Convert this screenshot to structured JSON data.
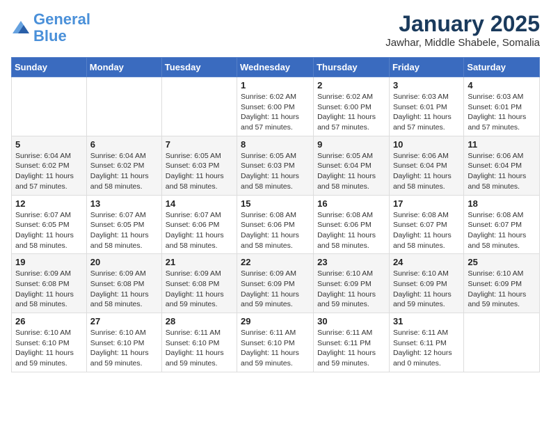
{
  "logo": {
    "line1": "General",
    "line2": "Blue"
  },
  "title": "January 2025",
  "subtitle": "Jawhar, Middle Shabele, Somalia",
  "days_header": [
    "Sunday",
    "Monday",
    "Tuesday",
    "Wednesday",
    "Thursday",
    "Friday",
    "Saturday"
  ],
  "weeks": [
    [
      {
        "day": "",
        "info": ""
      },
      {
        "day": "",
        "info": ""
      },
      {
        "day": "",
        "info": ""
      },
      {
        "day": "1",
        "info": "Sunrise: 6:02 AM\nSunset: 6:00 PM\nDaylight: 11 hours and 57 minutes."
      },
      {
        "day": "2",
        "info": "Sunrise: 6:02 AM\nSunset: 6:00 PM\nDaylight: 11 hours and 57 minutes."
      },
      {
        "day": "3",
        "info": "Sunrise: 6:03 AM\nSunset: 6:01 PM\nDaylight: 11 hours and 57 minutes."
      },
      {
        "day": "4",
        "info": "Sunrise: 6:03 AM\nSunset: 6:01 PM\nDaylight: 11 hours and 57 minutes."
      }
    ],
    [
      {
        "day": "5",
        "info": "Sunrise: 6:04 AM\nSunset: 6:02 PM\nDaylight: 11 hours and 57 minutes."
      },
      {
        "day": "6",
        "info": "Sunrise: 6:04 AM\nSunset: 6:02 PM\nDaylight: 11 hours and 58 minutes."
      },
      {
        "day": "7",
        "info": "Sunrise: 6:05 AM\nSunset: 6:03 PM\nDaylight: 11 hours and 58 minutes."
      },
      {
        "day": "8",
        "info": "Sunrise: 6:05 AM\nSunset: 6:03 PM\nDaylight: 11 hours and 58 minutes."
      },
      {
        "day": "9",
        "info": "Sunrise: 6:05 AM\nSunset: 6:04 PM\nDaylight: 11 hours and 58 minutes."
      },
      {
        "day": "10",
        "info": "Sunrise: 6:06 AM\nSunset: 6:04 PM\nDaylight: 11 hours and 58 minutes."
      },
      {
        "day": "11",
        "info": "Sunrise: 6:06 AM\nSunset: 6:04 PM\nDaylight: 11 hours and 58 minutes."
      }
    ],
    [
      {
        "day": "12",
        "info": "Sunrise: 6:07 AM\nSunset: 6:05 PM\nDaylight: 11 hours and 58 minutes."
      },
      {
        "day": "13",
        "info": "Sunrise: 6:07 AM\nSunset: 6:05 PM\nDaylight: 11 hours and 58 minutes."
      },
      {
        "day": "14",
        "info": "Sunrise: 6:07 AM\nSunset: 6:06 PM\nDaylight: 11 hours and 58 minutes."
      },
      {
        "day": "15",
        "info": "Sunrise: 6:08 AM\nSunset: 6:06 PM\nDaylight: 11 hours and 58 minutes."
      },
      {
        "day": "16",
        "info": "Sunrise: 6:08 AM\nSunset: 6:06 PM\nDaylight: 11 hours and 58 minutes."
      },
      {
        "day": "17",
        "info": "Sunrise: 6:08 AM\nSunset: 6:07 PM\nDaylight: 11 hours and 58 minutes."
      },
      {
        "day": "18",
        "info": "Sunrise: 6:08 AM\nSunset: 6:07 PM\nDaylight: 11 hours and 58 minutes."
      }
    ],
    [
      {
        "day": "19",
        "info": "Sunrise: 6:09 AM\nSunset: 6:08 PM\nDaylight: 11 hours and 58 minutes."
      },
      {
        "day": "20",
        "info": "Sunrise: 6:09 AM\nSunset: 6:08 PM\nDaylight: 11 hours and 58 minutes."
      },
      {
        "day": "21",
        "info": "Sunrise: 6:09 AM\nSunset: 6:08 PM\nDaylight: 11 hours and 59 minutes."
      },
      {
        "day": "22",
        "info": "Sunrise: 6:09 AM\nSunset: 6:09 PM\nDaylight: 11 hours and 59 minutes."
      },
      {
        "day": "23",
        "info": "Sunrise: 6:10 AM\nSunset: 6:09 PM\nDaylight: 11 hours and 59 minutes."
      },
      {
        "day": "24",
        "info": "Sunrise: 6:10 AM\nSunset: 6:09 PM\nDaylight: 11 hours and 59 minutes."
      },
      {
        "day": "25",
        "info": "Sunrise: 6:10 AM\nSunset: 6:09 PM\nDaylight: 11 hours and 59 minutes."
      }
    ],
    [
      {
        "day": "26",
        "info": "Sunrise: 6:10 AM\nSunset: 6:10 PM\nDaylight: 11 hours and 59 minutes."
      },
      {
        "day": "27",
        "info": "Sunrise: 6:10 AM\nSunset: 6:10 PM\nDaylight: 11 hours and 59 minutes."
      },
      {
        "day": "28",
        "info": "Sunrise: 6:11 AM\nSunset: 6:10 PM\nDaylight: 11 hours and 59 minutes."
      },
      {
        "day": "29",
        "info": "Sunrise: 6:11 AM\nSunset: 6:10 PM\nDaylight: 11 hours and 59 minutes."
      },
      {
        "day": "30",
        "info": "Sunrise: 6:11 AM\nSunset: 6:11 PM\nDaylight: 11 hours and 59 minutes."
      },
      {
        "day": "31",
        "info": "Sunrise: 6:11 AM\nSunset: 6:11 PM\nDaylight: 12 hours and 0 minutes."
      },
      {
        "day": "",
        "info": ""
      }
    ]
  ]
}
